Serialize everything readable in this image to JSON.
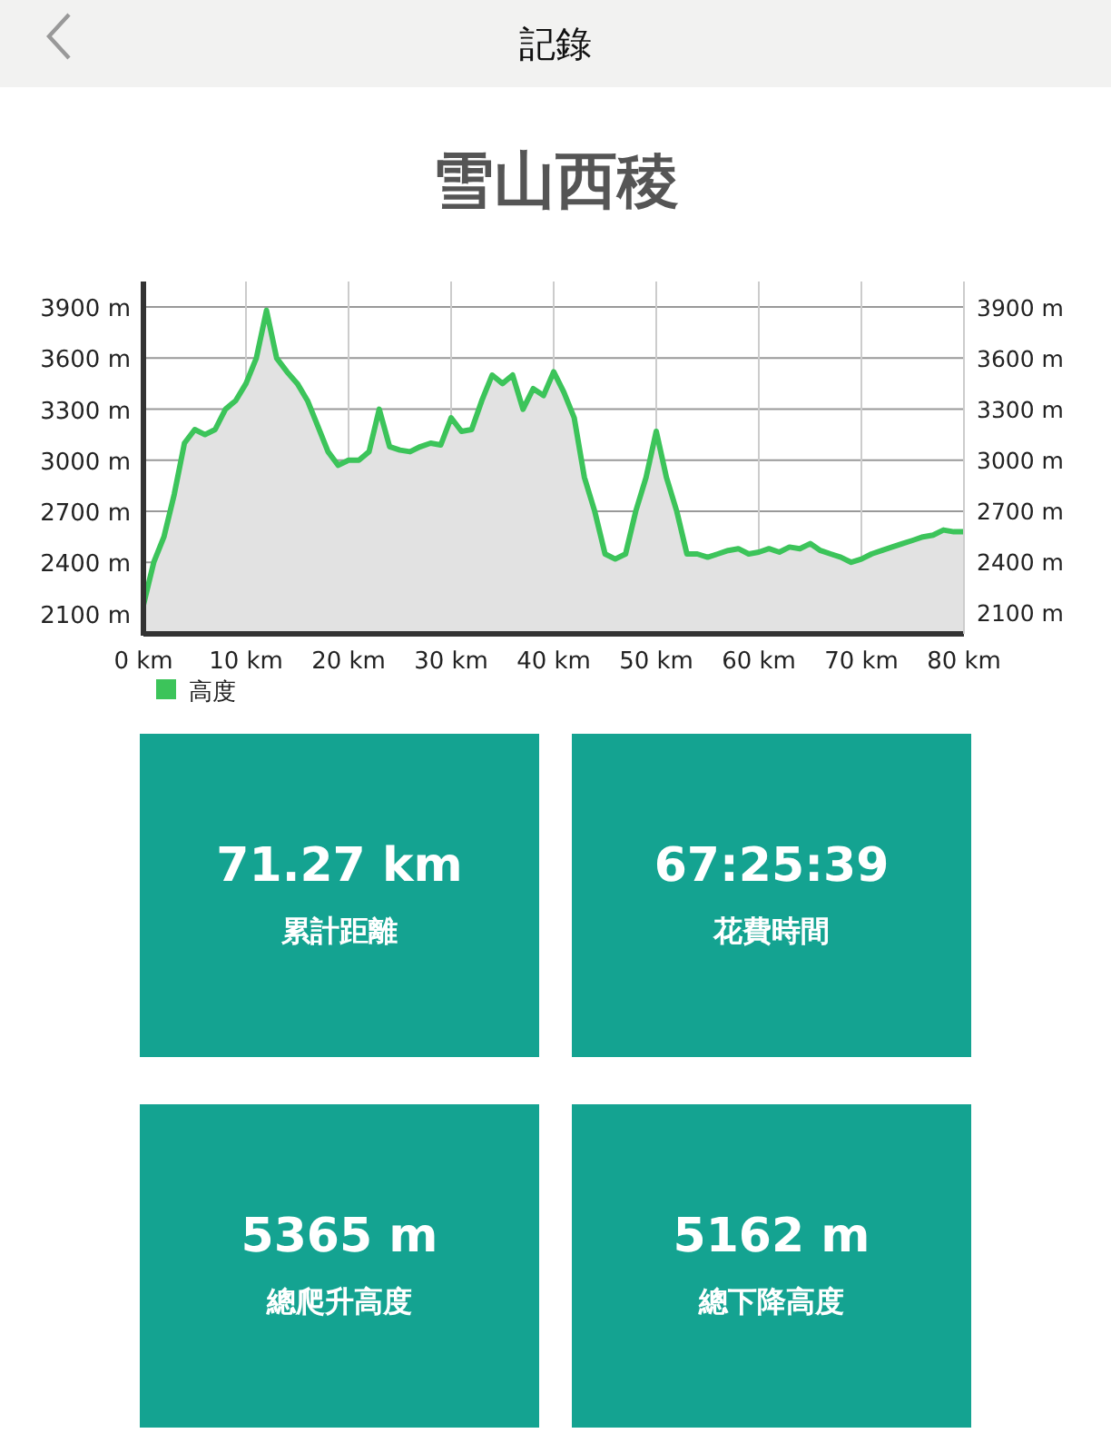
{
  "header": {
    "title": "記錄"
  },
  "route_title": "雪山西稜",
  "elevation": {
    "chart_data": {
      "type": "area",
      "x": [
        0,
        1,
        2,
        3,
        4,
        5,
        6,
        7,
        8,
        9,
        10,
        11,
        12,
        13,
        14,
        15,
        16,
        17,
        18,
        19,
        20,
        21,
        22,
        23,
        24,
        25,
        26,
        27,
        28,
        29,
        30,
        31,
        32,
        33,
        34,
        35,
        36,
        37,
        38,
        39,
        40,
        41,
        42,
        43,
        44,
        45,
        46,
        47,
        48,
        49,
        50,
        51,
        52,
        53,
        54,
        55,
        56,
        57,
        58,
        59,
        60,
        61,
        62,
        63,
        64,
        65,
        66,
        67,
        68,
        69,
        70,
        71,
        72,
        73,
        74,
        75,
        76,
        77,
        78,
        79,
        80
      ],
      "series": [
        {
          "name": "高度",
          "color": "#3cc45a",
          "values": [
            2150,
            2400,
            2550,
            2800,
            3100,
            3180,
            3150,
            3180,
            3300,
            3350,
            3450,
            3600,
            3880,
            3600,
            3520,
            3450,
            3350,
            3200,
            3050,
            2970,
            3000,
            3000,
            3050,
            3300,
            3080,
            3060,
            3050,
            3080,
            3100,
            3090,
            3250,
            3170,
            3180,
            3350,
            3500,
            3450,
            3500,
            3300,
            3420,
            3380,
            3520,
            3400,
            3250,
            2900,
            2700,
            2450,
            2420,
            2450,
            2700,
            2900,
            3170,
            2900,
            2700,
            2450,
            2450,
            2430,
            2450,
            2470,
            2480,
            2450,
            2460,
            2480,
            2460,
            2490,
            2480,
            2510,
            2470,
            2450,
            2430,
            2400,
            2420,
            2450,
            2470,
            2490,
            2510,
            2530,
            2550,
            2560,
            2590,
            2580,
            2580
          ]
        }
      ],
      "xlim": [
        0,
        80
      ],
      "ylim": [
        1980,
        4050
      ],
      "xticks": [
        {
          "value": 0,
          "label": "0 km"
        },
        {
          "value": 10,
          "label": "10 km"
        },
        {
          "value": 20,
          "label": "20 km"
        },
        {
          "value": 30,
          "label": "30 km"
        },
        {
          "value": 40,
          "label": "40 km"
        },
        {
          "value": 50,
          "label": "50 km"
        },
        {
          "value": 60,
          "label": "60 km"
        },
        {
          "value": 70,
          "label": "70 km"
        },
        {
          "value": 80,
          "label": "80 km"
        }
      ],
      "yticks": [
        {
          "value": 2100,
          "label": "2100 m"
        },
        {
          "value": 2400,
          "label": "2400 m"
        },
        {
          "value": 2700,
          "label": "2700 m"
        },
        {
          "value": 3000,
          "label": "3000 m"
        },
        {
          "value": 3300,
          "label": "3300 m"
        },
        {
          "value": 3600,
          "label": "3600 m"
        },
        {
          "value": 3900,
          "label": "3900 m"
        }
      ],
      "grid": true
    },
    "right_axis_labels": [
      "3900 m",
      "3600 m",
      "3300 m",
      "3000 m",
      "2700 m",
      "2400 m",
      "2100 m"
    ]
  },
  "stats": [
    {
      "value": "71.27 km",
      "label": "累計距離"
    },
    {
      "value": "67:25:39",
      "label": "花費時間"
    },
    {
      "value": "5365 m",
      "label": "總爬升高度"
    },
    {
      "value": "5162 m",
      "label": "總下降高度"
    }
  ]
}
